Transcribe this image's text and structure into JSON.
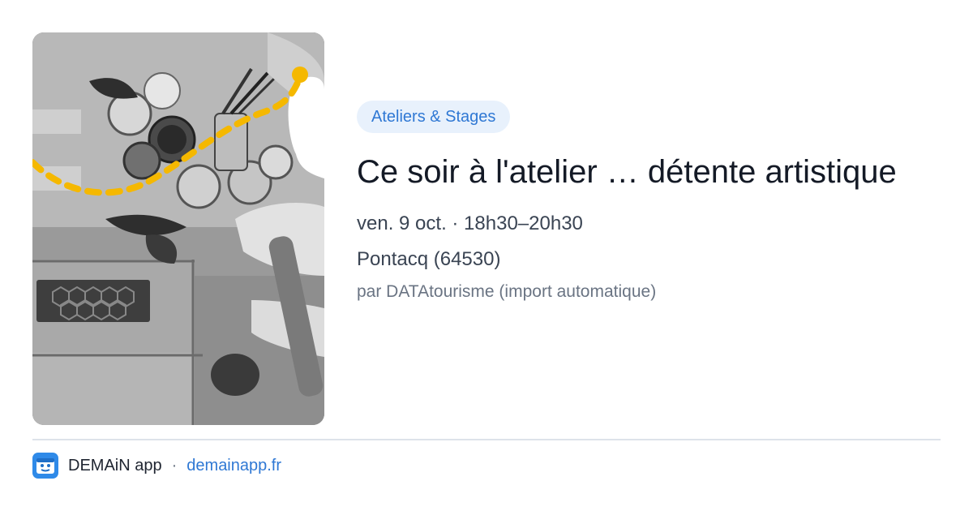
{
  "card": {
    "tag": "Ateliers & Stages",
    "title": "Ce soir à l'atelier … détente artistique",
    "date": "ven. 9 oct. · 18h30–20h30",
    "place": "Pontacq (64530)",
    "source": "par DATAtourisme (import automatique)"
  },
  "footer": {
    "app_name": "DEMAiN app",
    "separator": "·",
    "link": "demainapp.fr"
  },
  "colors": {
    "accent": "#2f78d4",
    "tag_bg": "#e8f1fc",
    "dashed_path": "#f5b800",
    "title": "#141a26"
  },
  "image": {
    "description_icon": "photo-workshop-pottery"
  }
}
